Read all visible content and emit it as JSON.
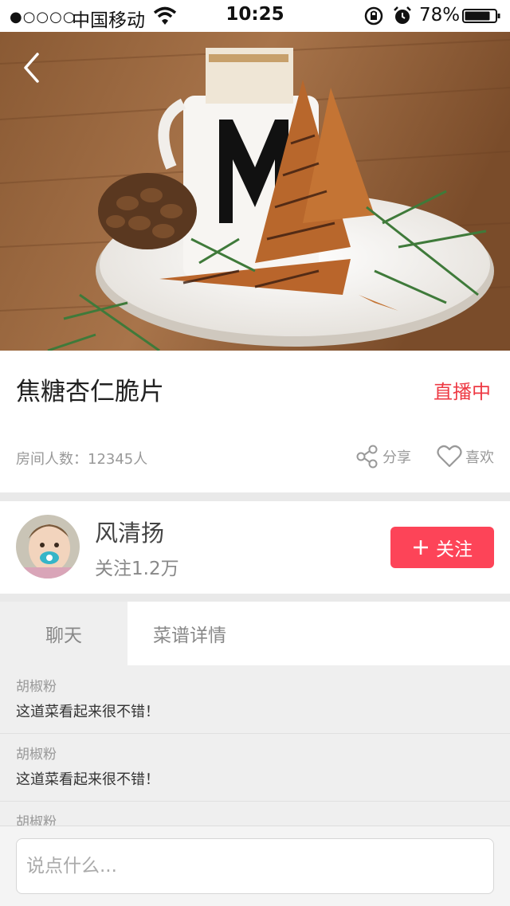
{
  "status_bar": {
    "signal": "●○○○○",
    "carrier": "中国移动",
    "time": "10:25",
    "battery": "78%"
  },
  "recipe": {
    "title": "焦糖杏仁脆片",
    "live_label": "直播中",
    "room_count": "房间人数：12345人",
    "share_label": "分享",
    "like_label": "喜欢"
  },
  "host": {
    "name": "风清扬",
    "followers": "关注1.2万",
    "follow_button": "关注"
  },
  "tabs": [
    {
      "label": "聊天"
    },
    {
      "label": "菜谱详情"
    }
  ],
  "chat": {
    "messages": [
      {
        "user": "胡椒粉",
        "text": "这道菜看起来很不错！"
      },
      {
        "user": "胡椒粉",
        "text": "这道菜看起来很不错！"
      },
      {
        "user": "胡椒粉",
        "text": ""
      }
    ],
    "input_placeholder": "说点什么..."
  },
  "colors": {
    "accent_red": "#fd4458",
    "live_red": "#ee3a44"
  }
}
